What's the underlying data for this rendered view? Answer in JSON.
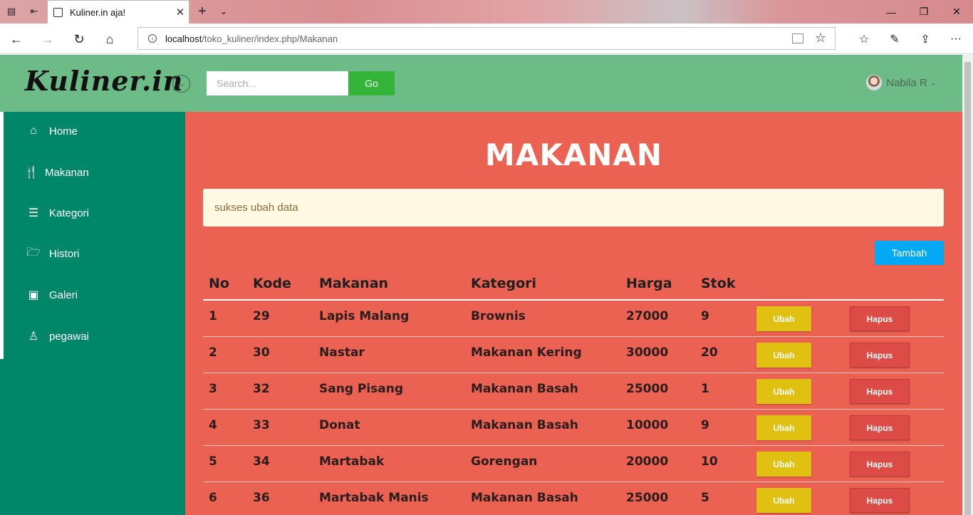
{
  "browser": {
    "tab_title": "Kuliner.in aja!",
    "url_host": "localhost",
    "url_path": "/toko_kuliner/index.php/Makanan"
  },
  "header": {
    "logo": "Kuliner.in",
    "search_placeholder": "Search...",
    "go_label": "Go",
    "user_name": "Nabila R"
  },
  "sidebar": {
    "items": [
      {
        "label": "Home",
        "icon": "home-icon"
      },
      {
        "label": "Makanan",
        "icon": "utensils-icon"
      },
      {
        "label": "Kategori",
        "icon": "list-icon"
      },
      {
        "label": "Histori",
        "icon": "folder-open-icon"
      },
      {
        "label": "Galeri",
        "icon": "camera-icon"
      },
      {
        "label": "pegawai",
        "icon": "user-icon"
      }
    ]
  },
  "main": {
    "title": "MAKANAN",
    "alert": "sukses ubah data",
    "add_label": "Tambah",
    "columns": [
      "No",
      "Kode",
      "Makanan",
      "Kategori",
      "Harga",
      "Stok"
    ],
    "edit_label": "Ubah",
    "delete_label": "Hapus",
    "rows": [
      {
        "no": "1",
        "kode": "29",
        "makanan": "Lapis Malang",
        "kategori": "Brownis",
        "harga": "27000",
        "stok": "9"
      },
      {
        "no": "2",
        "kode": "30",
        "makanan": "Nastar",
        "kategori": "Makanan Kering",
        "harga": "30000",
        "stok": "20"
      },
      {
        "no": "3",
        "kode": "32",
        "makanan": "Sang Pisang",
        "kategori": "Makanan Basah",
        "harga": "25000",
        "stok": "1"
      },
      {
        "no": "4",
        "kode": "33",
        "makanan": "Donat",
        "kategori": "Makanan Basah",
        "harga": "10000",
        "stok": "9"
      },
      {
        "no": "5",
        "kode": "34",
        "makanan": "Martabak",
        "kategori": "Gorengan",
        "harga": "20000",
        "stok": "10"
      },
      {
        "no": "6",
        "kode": "36",
        "makanan": "Martabak Manis",
        "kategori": "Makanan Basah",
        "harga": "25000",
        "stok": "5"
      }
    ]
  },
  "colors": {
    "header_bg": "#6dbb86",
    "sidebar_bg": "#00876a",
    "main_bg": "#ec6252",
    "go_button": "#34b53a",
    "add_button": "#03a9f4",
    "edit_button": "#e0c010",
    "delete_button": "#dc4b45"
  }
}
